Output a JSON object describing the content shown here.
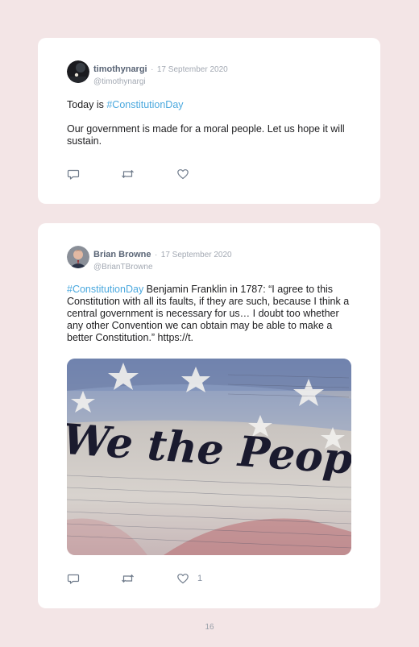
{
  "tweets": [
    {
      "name": "timothynargi",
      "separator": "·",
      "date": "17 September 2020",
      "handle": "@timothynargi",
      "text_prefix": "Today is ",
      "hashtag": "#ConstitutionDay",
      "body": "Our government is made for a moral people. Let us hope it will sustain.",
      "likes": ""
    },
    {
      "name": "Brian Browne",
      "separator": "·",
      "date": "17 September 2020",
      "handle": "@BrianTBrowne",
      "hashtag": "#ConstitutionDay",
      "text": " Benjamin Franklin in 1787: “I agree to this Constitution with all its faults, if they are such, because I think a central government is necessary for us… I doubt too whether any other Convention we can obtain may be able to make a better Constitution.” https://t.",
      "image_text": "We the People",
      "likes": "1"
    }
  ],
  "page_number": "16",
  "colors": {
    "hashtag": "#4aa8de",
    "background": "#f3e5e6"
  },
  "icons": [
    "reply-icon",
    "retweet-icon",
    "like-icon"
  ]
}
